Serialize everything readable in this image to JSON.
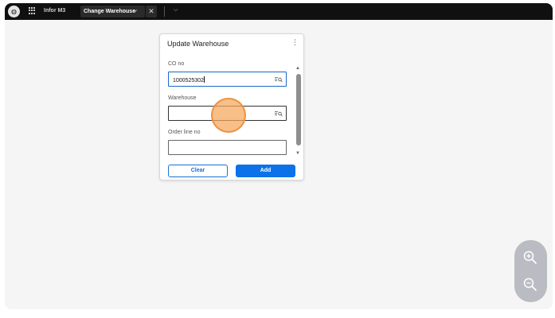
{
  "topbar": {
    "app_name": "Infor M3",
    "tab_label": "Change Warehouse",
    "tab_chevron": "⌵",
    "tab_close": "✕",
    "toolbar_chevron": "⌵",
    "logo_icon": "globe-icon"
  },
  "dialog": {
    "title": "Update Warehouse",
    "menu_icon": "⋮",
    "fields": [
      {
        "label": "CO no",
        "value": "1000525302",
        "icon": "lookup-icon"
      },
      {
        "label": "Warehouse",
        "value": "",
        "icon": "lookup-icon"
      },
      {
        "label": "Order line no",
        "value": ""
      }
    ],
    "clear_label": "Clear",
    "add_label": "Add",
    "scroll_up": "▲",
    "scroll_down": "▼"
  },
  "zoom": {
    "zoom_in_icon": "zoom-in-icon",
    "zoom_out_icon": "zoom-out-icon"
  },
  "colors": {
    "topbar_bg": "#101010",
    "accent": "#0b72e7",
    "canvas_bg": "#f5f5f5",
    "click_indicator": "#f5a65a"
  }
}
